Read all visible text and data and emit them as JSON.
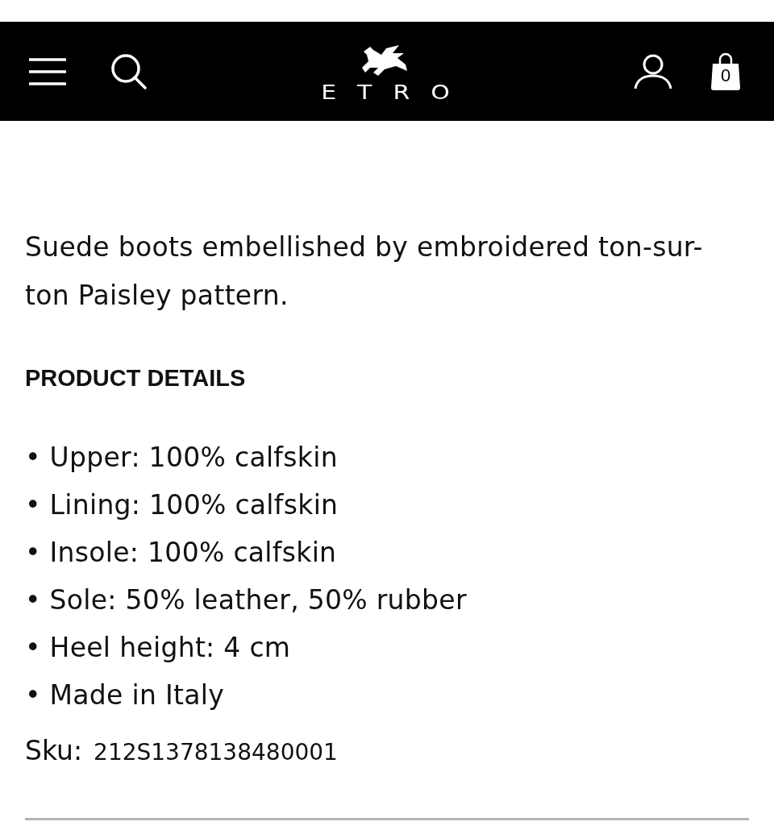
{
  "header": {
    "logo": "ETRO",
    "cart_count": "0"
  },
  "description": "Suede boots embellished by embroidered ton-sur-ton Paisley pattern.",
  "details_heading": "PRODUCT DETAILS",
  "details": [
    "• Upper: 100% calfskin",
    "• Lining: 100% calfskin",
    "• Insole: 100% calfskin",
    "• Sole: 50% leather, 50% rubber",
    "• Heel height: 4 cm",
    "• Made in Italy"
  ],
  "sku": {
    "label": "Sku:",
    "value": "212S1378138480001"
  }
}
